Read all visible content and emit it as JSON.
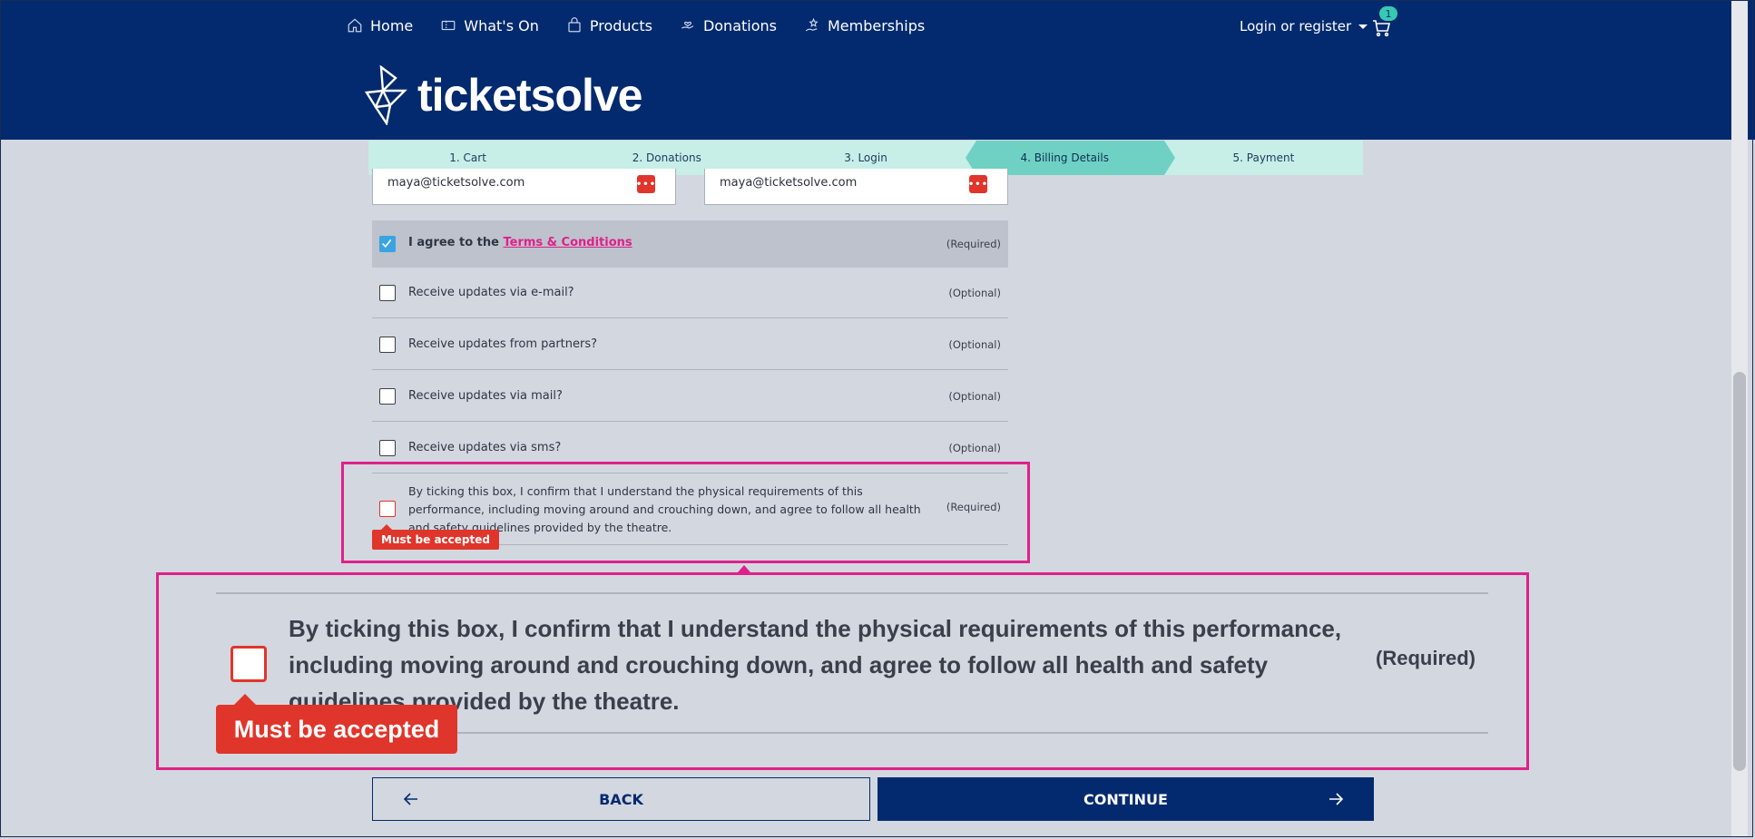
{
  "nav": {
    "items": [
      {
        "label": "Home",
        "icon": "home-icon"
      },
      {
        "label": "What's On",
        "icon": "ticket-icon"
      },
      {
        "label": "Products",
        "icon": "bag-icon"
      },
      {
        "label": "Donations",
        "icon": "hand-heart-icon"
      },
      {
        "label": "Memberships",
        "icon": "star-hand-icon"
      }
    ],
    "login_label": "Login or register",
    "cart_count": "1"
  },
  "logo": {
    "text": "ticketsolve"
  },
  "steps": [
    {
      "label": "1. Cart",
      "active": false
    },
    {
      "label": "2. Donations",
      "active": false
    },
    {
      "label": "3. Login",
      "active": false
    },
    {
      "label": "4. Billing Details",
      "active": true
    },
    {
      "label": "5. Payment",
      "active": false
    }
  ],
  "form": {
    "email_value": "maya@ticketsolve.com",
    "confirm_email_value": "maya@ticketsolve.com",
    "agree_prefix": "I agree to the ",
    "agree_link": "Terms & Conditions",
    "required_tag": "(Required)",
    "optional_tag": "(Optional)",
    "options": [
      {
        "label": "Receive updates via e-mail?"
      },
      {
        "label": "Receive updates from partners?"
      },
      {
        "label": "Receive updates via mail?"
      },
      {
        "label": "Receive updates via sms?"
      }
    ],
    "physical_requirements": "By ticking this box, I confirm that I understand the physical requirements of this performance, including moving around and crouching down, and agree to follow all health and safety guidelines provided by the theatre.",
    "error_message": "Must be accepted"
  },
  "buttons": {
    "back": "BACK",
    "continue": "CONTINUE"
  },
  "colors": {
    "header": "#032a6e",
    "accent_teal": "#6fd1c4",
    "error_red": "#e0352b",
    "highlight_pink": "#e0208a"
  }
}
